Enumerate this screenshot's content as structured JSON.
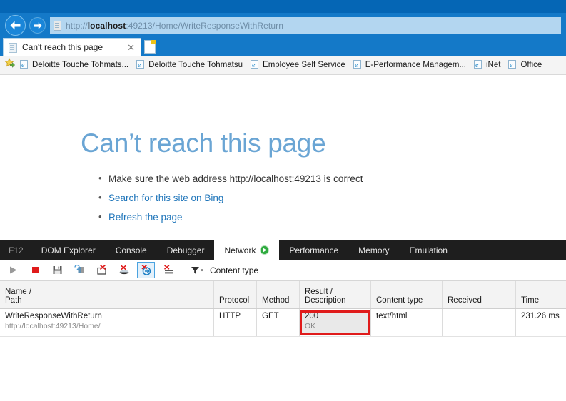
{
  "browser": {
    "back_icon": "back-arrow-icon",
    "forward_icon": "forward-arrow-icon",
    "address": {
      "prefix": "http://",
      "host": "localhost",
      "rest": ":49213/Home/WriteResponseWithReturn",
      "full": "http://localhost:49213/Home/WriteResponseWithReturn",
      "icon": "page-icon"
    },
    "tab": {
      "title": "Can't reach this page",
      "close_label": "✕",
      "favicon": "page-icon"
    },
    "new_tab_label": "new-tab-icon",
    "favorites": {
      "star_icon": "favorites-star-icon",
      "items": [
        {
          "label": "Deloitte Touche Tohmats...",
          "icon": "ie-icon"
        },
        {
          "label": "Deloitte Touche Tohmatsu",
          "icon": "ie-icon"
        },
        {
          "label": "Employee Self Service",
          "icon": "ie-icon"
        },
        {
          "label": "E-Performance Managem...",
          "icon": "ie-icon"
        },
        {
          "label": "iNet",
          "icon": "ie-icon"
        },
        {
          "label": "Office",
          "icon": "ie-icon"
        }
      ]
    }
  },
  "error_page": {
    "title": "Can’t reach this page",
    "suggestions": [
      {
        "text": "Make sure the web address http://localhost:49213 is correct",
        "is_link": false
      },
      {
        "text": "Search for this site on Bing",
        "is_link": true
      },
      {
        "text": "Refresh the page",
        "is_link": true
      }
    ]
  },
  "devtools": {
    "f12_label": "F12",
    "tabs": [
      {
        "label": "DOM Explorer",
        "active": false
      },
      {
        "label": "Console",
        "active": false
      },
      {
        "label": "Debugger",
        "active": false
      },
      {
        "label": "Network",
        "active": true,
        "icon": "green-play-icon"
      },
      {
        "label": "Performance",
        "active": false
      },
      {
        "label": "Memory",
        "active": false
      },
      {
        "label": "Emulation",
        "active": false
      }
    ],
    "toolbar": {
      "buttons": [
        {
          "name": "start-profiling-button",
          "icon": "play-icon",
          "selected": false
        },
        {
          "name": "stop-profiling-button",
          "icon": "stop-record-icon",
          "selected": false
        },
        {
          "name": "export-as-har-button",
          "icon": "save-icon",
          "selected": false
        },
        {
          "name": "import-har-button",
          "icon": "import-icon",
          "selected": false
        },
        {
          "name": "clear-entries-button",
          "icon": "clear-session-icon",
          "selected": false
        },
        {
          "name": "clear-cache-button",
          "icon": "clear-cache-icon",
          "selected": false
        },
        {
          "name": "clear-cookies-button",
          "icon": "clear-cookies-icon",
          "selected": true
        },
        {
          "name": "clear-on-navigate-button",
          "icon": "clear-on-navigate-icon",
          "selected": false
        }
      ],
      "filter_icon": "funnel-icon",
      "filter_label": "Content type"
    },
    "table": {
      "columns": [
        {
          "line1": "Name /",
          "line2": "Path",
          "key": "c-name"
        },
        {
          "line1": "",
          "line2": "Protocol",
          "key": "c-proto"
        },
        {
          "line1": "",
          "line2": "Method",
          "key": "c-method"
        },
        {
          "line1": "Result /",
          "line2": "Description",
          "key": "c-result",
          "underline": true
        },
        {
          "line1": "",
          "line2": "Content type",
          "key": "c-ctype"
        },
        {
          "line1": "",
          "line2": "Received",
          "key": "c-recv"
        },
        {
          "line1": "",
          "line2": "Time",
          "key": "c-time"
        }
      ],
      "rows": [
        {
          "name": "WriteResponseWithReturn",
          "path": "http://localhost:49213/Home/",
          "protocol": "HTTP",
          "method": "GET",
          "result": "200",
          "description": "OK",
          "content_type": "text/html",
          "received": "",
          "time": "231.26 ms"
        }
      ]
    },
    "highlight": {
      "name": "result-cell-highlight",
      "color": "#e01b1b"
    }
  },
  "colors": {
    "chrome_blue": "#1479c8",
    "title_blue": "#0566b5",
    "address_bar": "#b3d6f0",
    "devtools_dark": "#1e1e1e",
    "link_blue": "#2277bb",
    "error_title": "#6aa5d4",
    "highlight_red": "#e01b1b"
  }
}
